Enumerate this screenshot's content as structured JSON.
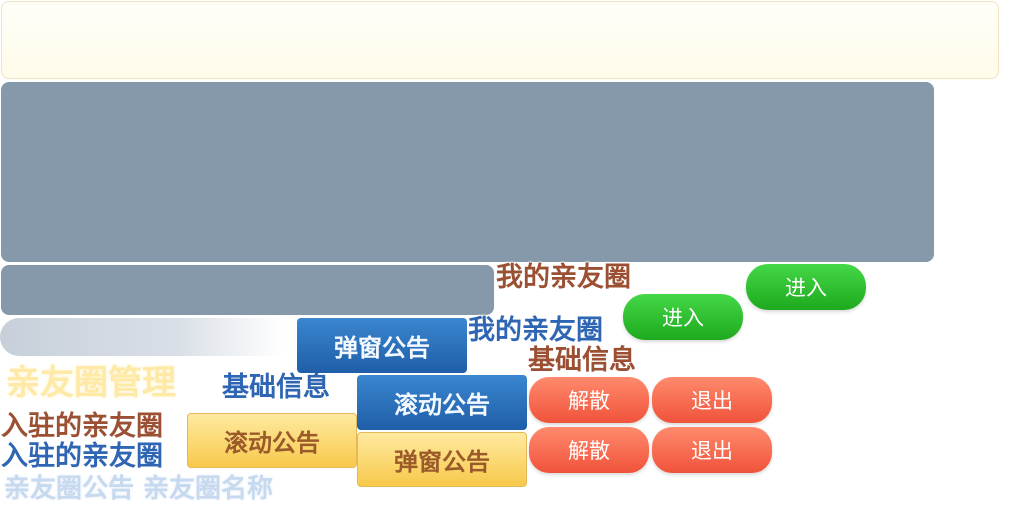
{
  "labels": {
    "my_circle_1": "我的亲友圈",
    "my_circle_2": "我的亲友圈",
    "basic_info_1": "基础信息",
    "basic_info_2": "基础信息",
    "circle_manage": "亲友圈管理",
    "joined_circle_1": "入驻的亲友圈",
    "joined_circle_2": "入驻的亲友圈",
    "circle_notice_name": "亲友圈公告 亲友圈名称"
  },
  "buttons": {
    "enter_1": "进入",
    "enter_2": "进入",
    "popup_notice_blue": "弹窗公告",
    "scroll_notice_blue": "滚动公告",
    "scroll_notice_yellow": "滚动公告",
    "popup_notice_yellow": "弹窗公告",
    "dissolve_1": "解散",
    "dissolve_2": "解散",
    "exit_1": "退出",
    "exit_2": "退出"
  },
  "colors": {
    "panel": "#8599aa",
    "brown_text": "#9b5033",
    "blue_text": "#2f66b4",
    "green_button": "#1ea91e",
    "red_button": "#f0533b",
    "blue_button": "#1f5ea8",
    "yellow_button": "#f7c94b"
  }
}
